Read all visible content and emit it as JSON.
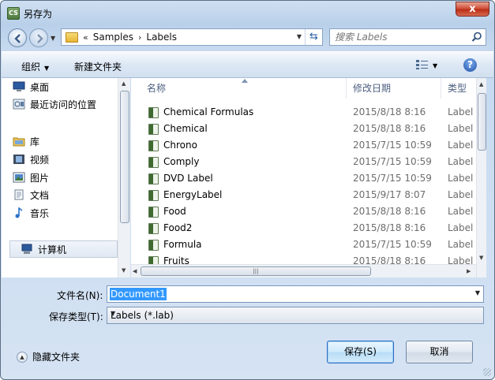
{
  "window": {
    "title": "另存为",
    "app_badge": "CS",
    "close_label": "x"
  },
  "address": {
    "overflow": "«",
    "crumbs": [
      "Samples",
      "Labels"
    ],
    "separator": "›"
  },
  "search": {
    "placeholder": "搜索 Labels"
  },
  "toolbar": {
    "organize_label": "组织",
    "new_folder_label": "新建文件夹"
  },
  "sidebar": {
    "items": [
      {
        "label": "桌面",
        "icon": "desktop-icon"
      },
      {
        "label": "最近访问的位置",
        "icon": "recent-places-icon"
      },
      {
        "label": "库",
        "icon": "library-icon"
      },
      {
        "label": "视频",
        "icon": "video-icon"
      },
      {
        "label": "图片",
        "icon": "pictures-icon"
      },
      {
        "label": "文档",
        "icon": "documents-icon"
      },
      {
        "label": "音乐",
        "icon": "music-icon"
      },
      {
        "label": "计算机",
        "icon": "computer-icon"
      }
    ]
  },
  "columns": {
    "name": "名称",
    "date": "修改日期",
    "type": "类型"
  },
  "files": [
    {
      "name": "Chemical Formulas",
      "date": "2015/8/18 8:16",
      "type": "Label"
    },
    {
      "name": "Chemical",
      "date": "2015/8/18 8:16",
      "type": "Label"
    },
    {
      "name": "Chrono",
      "date": "2015/7/15 10:59",
      "type": "Label"
    },
    {
      "name": "Comply",
      "date": "2015/7/15 10:59",
      "type": "Label"
    },
    {
      "name": "DVD Label",
      "date": "2015/7/15 10:59",
      "type": "Label"
    },
    {
      "name": "EnergyLabel",
      "date": "2015/9/17 8:07",
      "type": "Label"
    },
    {
      "name": "Food",
      "date": "2015/8/18 8:16",
      "type": "Label"
    },
    {
      "name": "Food2",
      "date": "2015/8/18 8:16",
      "type": "Label"
    },
    {
      "name": "Formula",
      "date": "2015/7/15 10:59",
      "type": "Label"
    },
    {
      "name": "Fruits",
      "date": "2015/8/18 8:16",
      "type": "Label"
    }
  ],
  "form": {
    "filename_label": "文件名(N):",
    "filename_value": "Document1",
    "filetype_label": "保存类型(T):",
    "filetype_value": "Labels (*.lab)"
  },
  "footer": {
    "hide_folders_label": "隐藏文件夹",
    "save_label": "保存(S)",
    "cancel_label": "取消"
  }
}
